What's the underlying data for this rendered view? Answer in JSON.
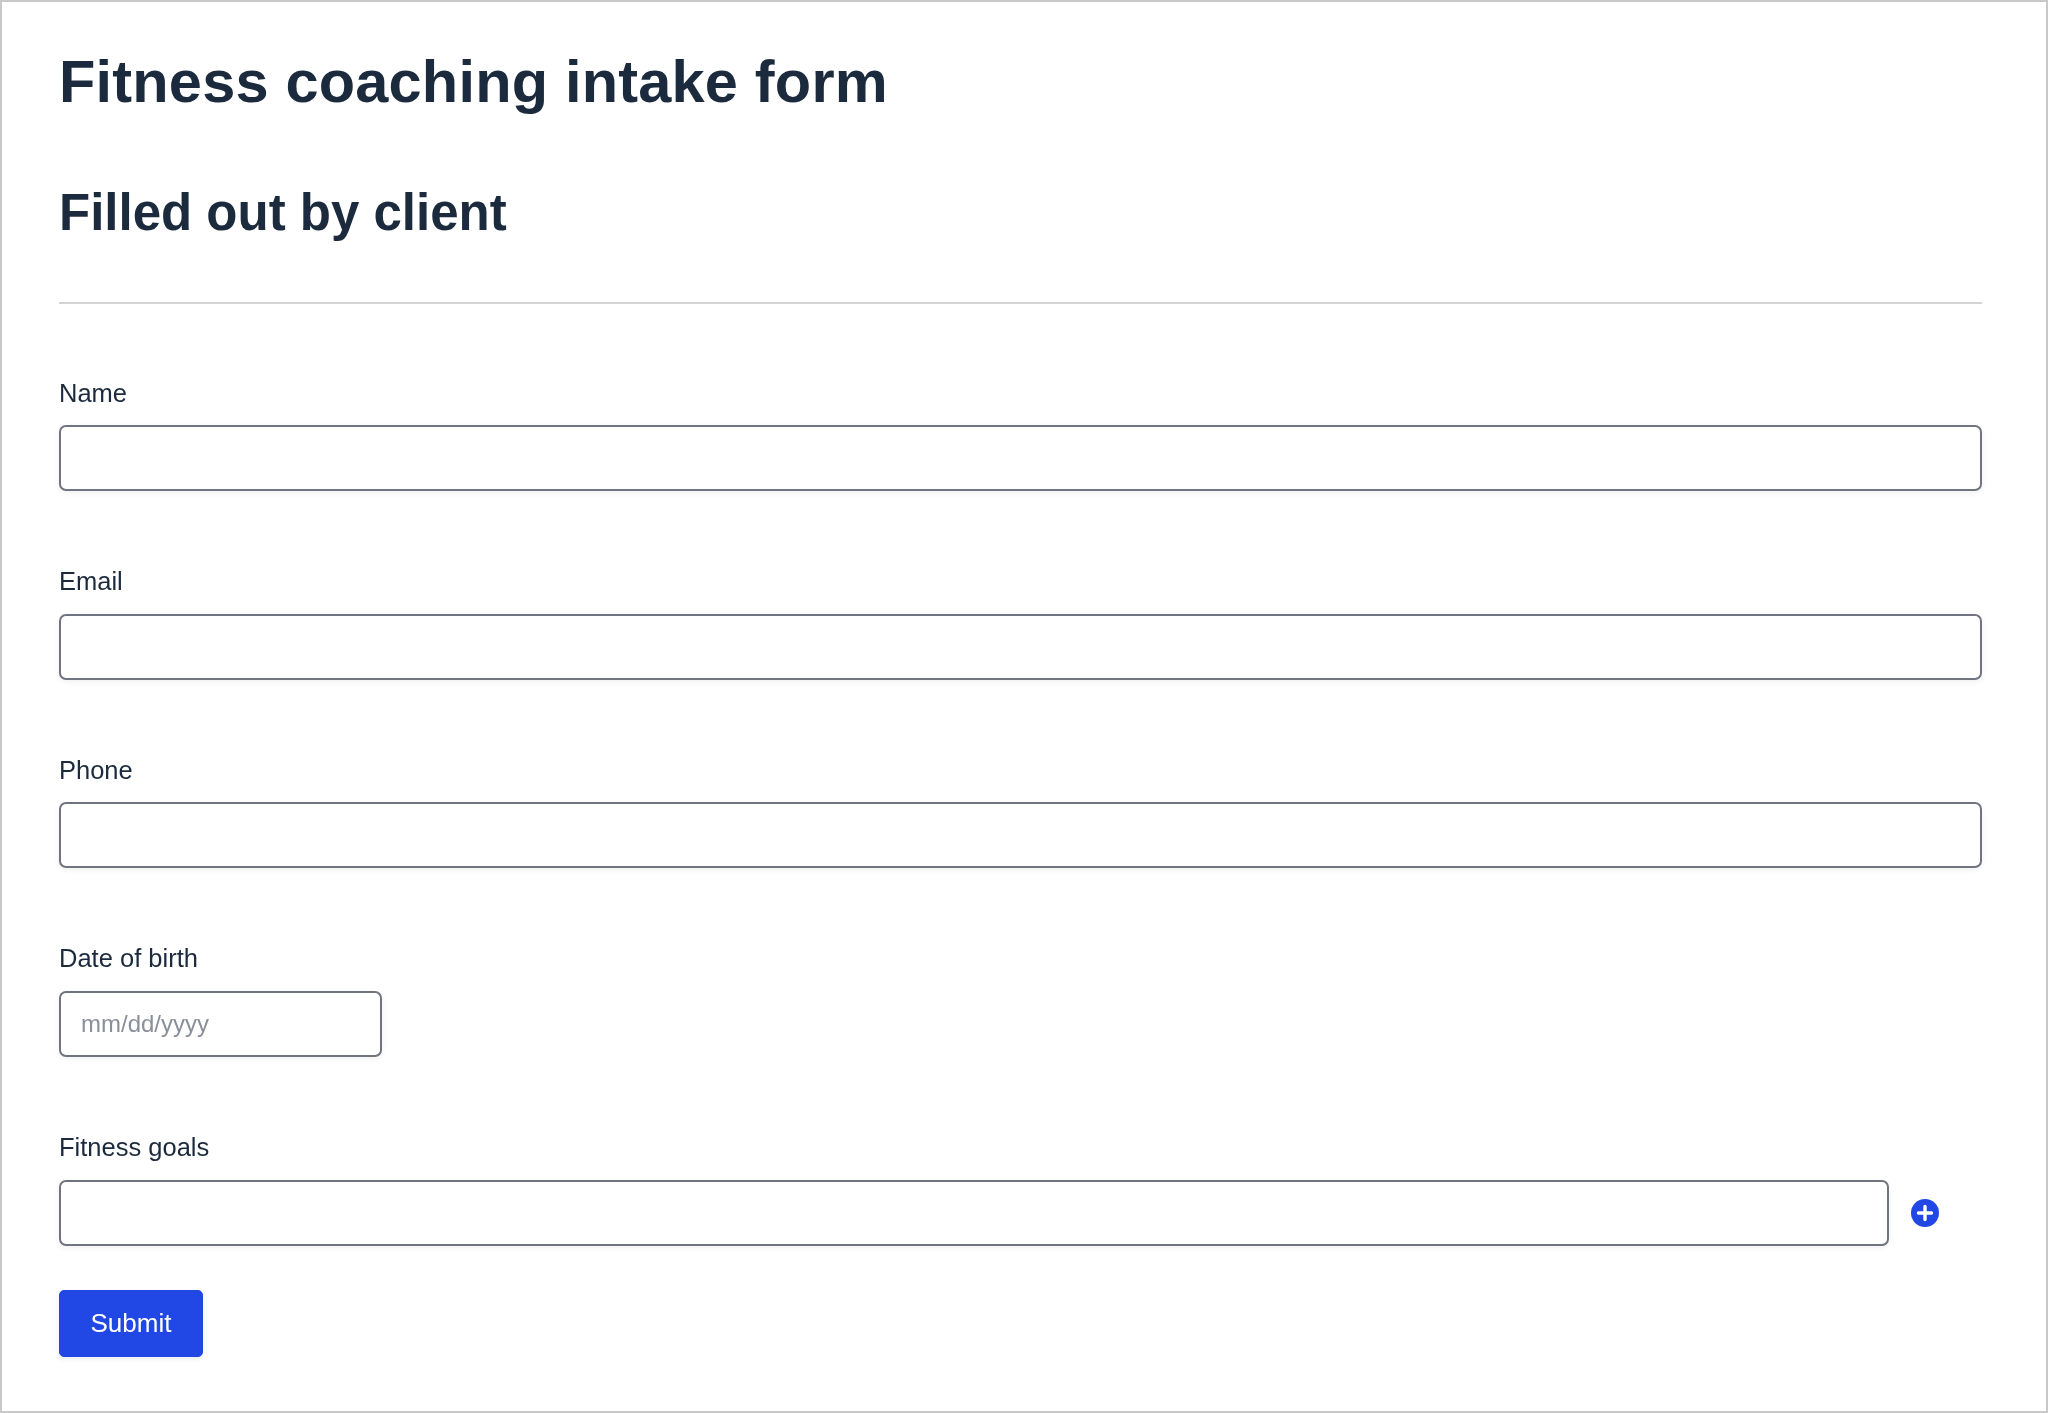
{
  "title": "Fitness coaching intake form",
  "section": {
    "heading": "Filled out by client"
  },
  "fields": [
    {
      "label": "Name",
      "kind": "text"
    },
    {
      "label": "Email",
      "kind": "text"
    },
    {
      "label": "Phone",
      "kind": "text"
    },
    {
      "label": "Date of birth",
      "kind": "date",
      "placeholder": "mm/dd/yyyy"
    },
    {
      "label": "Fitness goals",
      "kind": "repeatable"
    }
  ],
  "submit_button": {
    "label": "Submit"
  }
}
